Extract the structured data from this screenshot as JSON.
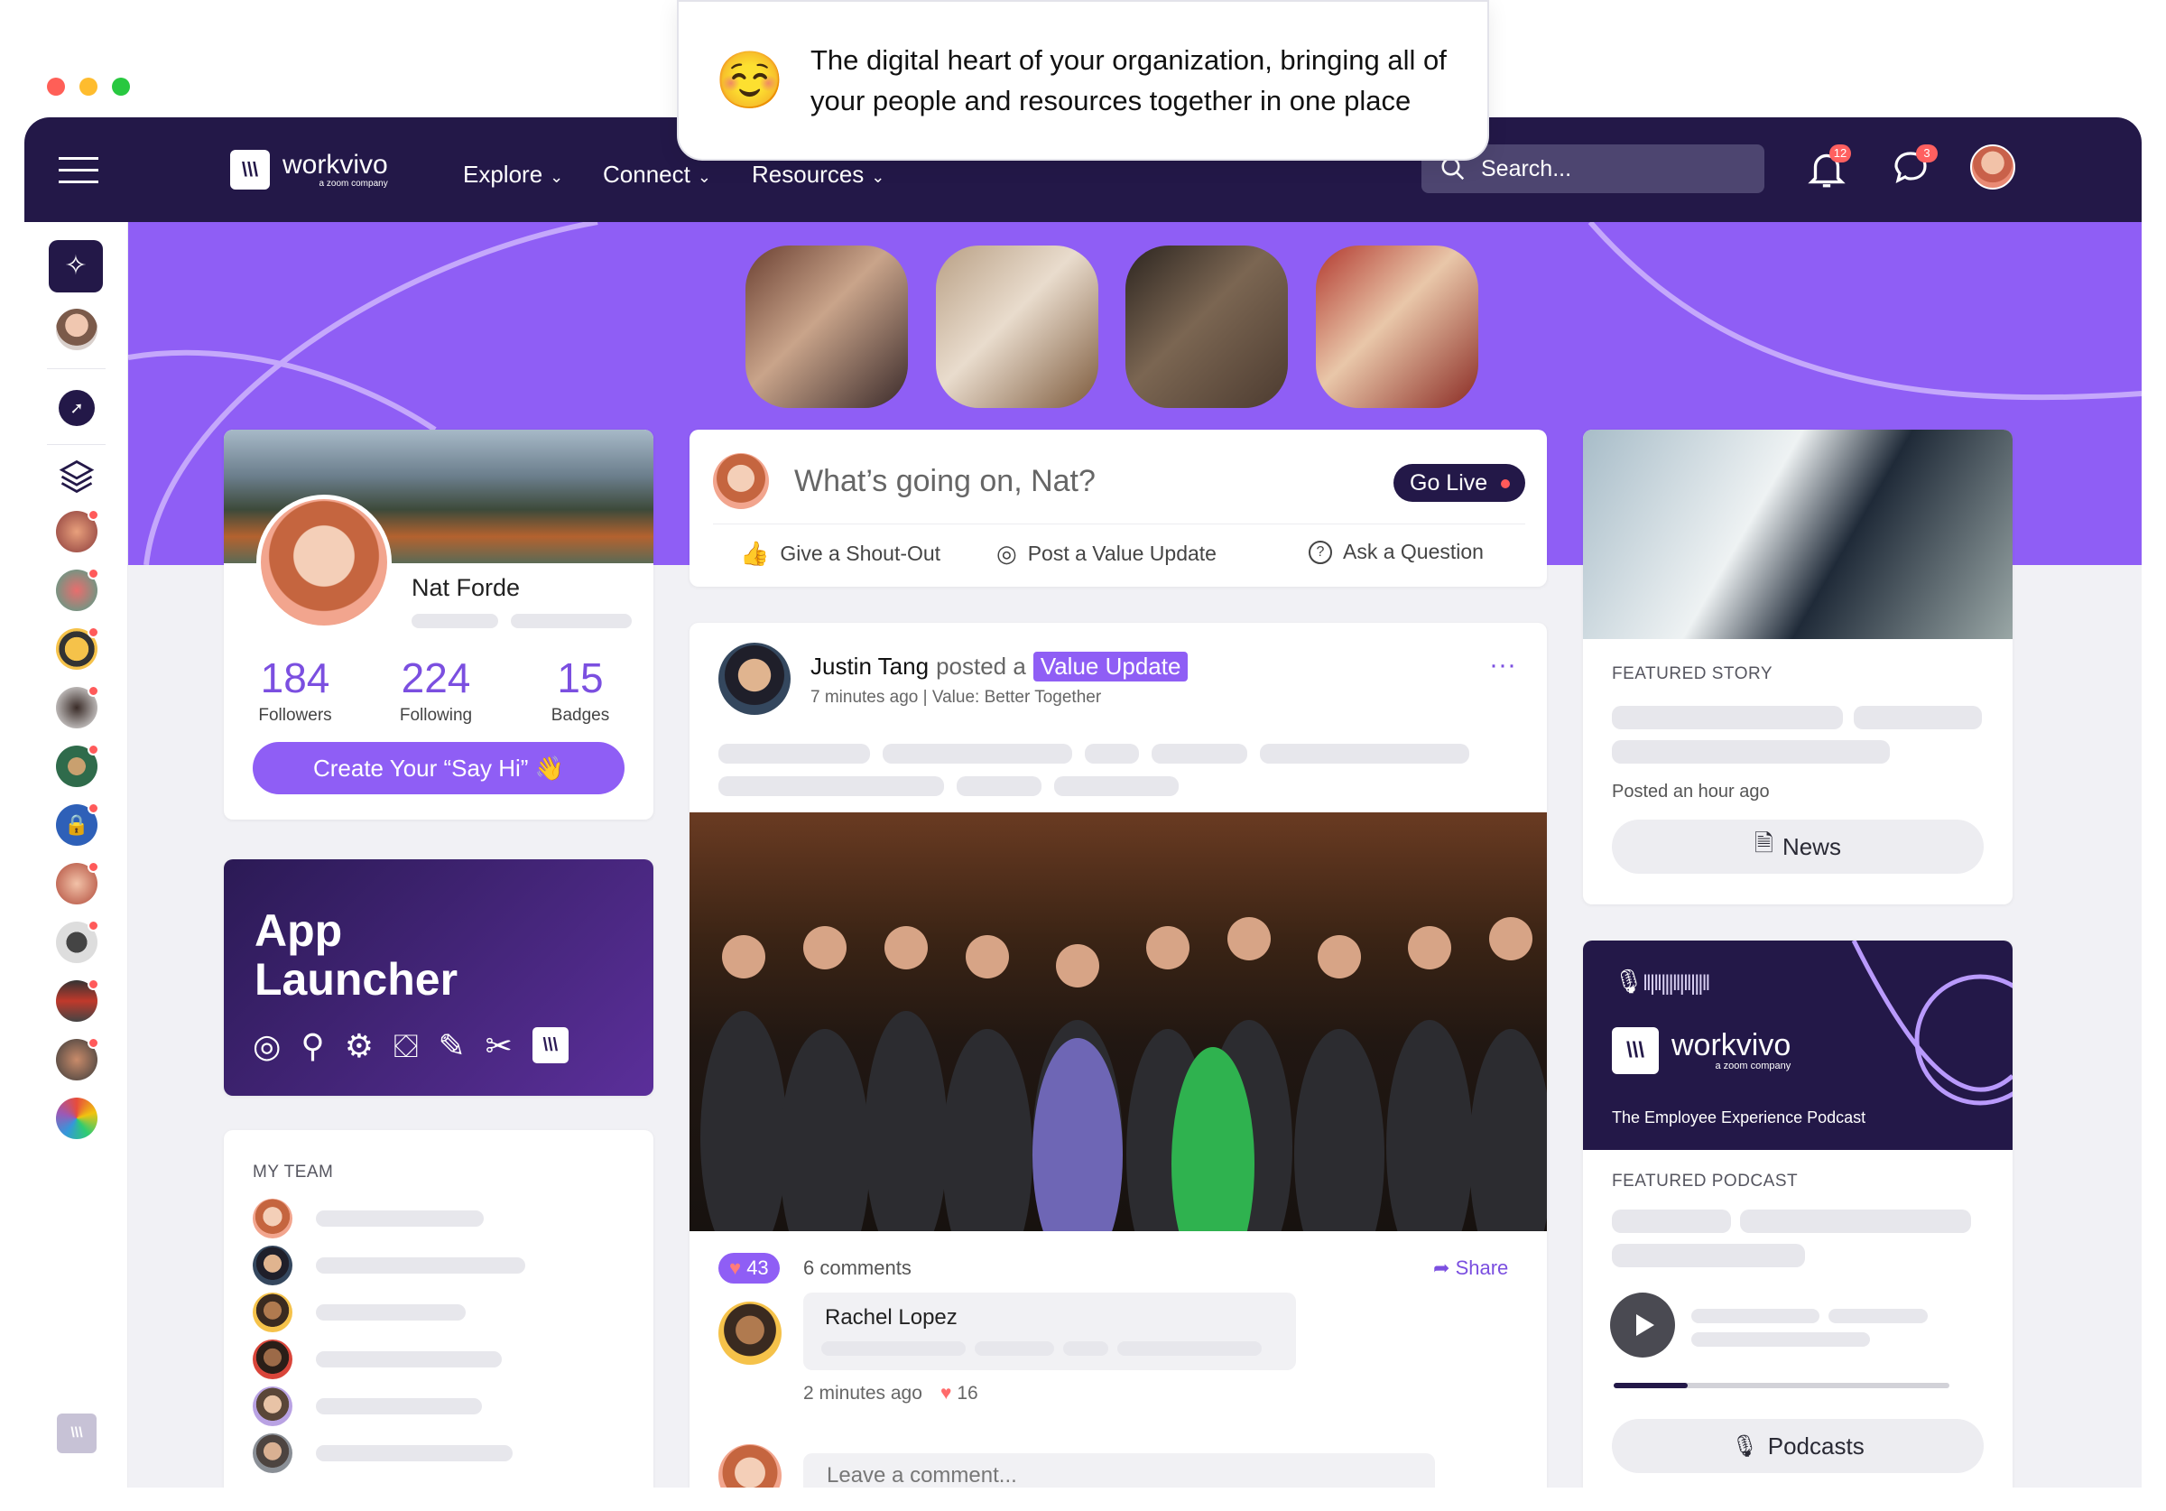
{
  "banner": {
    "emoji": "☺️",
    "text": "The digital heart of your organization, bringing all of your people and resources together in one place"
  },
  "nav": {
    "brand": "workvivo",
    "brand_sub": "a zoom company",
    "links": [
      "Explore",
      "Connect",
      "Resources"
    ],
    "search_placeholder": "Search...",
    "notifications_count": "12",
    "messages_count": "3"
  },
  "profile": {
    "name": "Nat Forde",
    "followers": "184",
    "followers_label": "Followers",
    "following": "224",
    "following_label": "Following",
    "badges": "15",
    "badges_label": "Badges",
    "say_hi_label": "Create Your “Say Hi” 👋"
  },
  "app_launcher": {
    "title_line1": "App",
    "title_line2": "Launcher"
  },
  "team": {
    "heading": "MY TEAM",
    "members": [
      {
        "status": "online"
      },
      {
        "status": "online"
      },
      {
        "status": "away"
      },
      {
        "status": "online"
      },
      {
        "status": "online"
      },
      {
        "status": "away"
      }
    ]
  },
  "composer": {
    "prompt": "What’s going on, Nat?",
    "go_live": "Go Live",
    "actions": [
      "Give a Shout-Out",
      "Post a Value Update",
      "Ask a Question"
    ]
  },
  "post": {
    "author": "Justin Tang",
    "verb": "posted a",
    "tag": "Value Update",
    "meta": "7 minutes ago | Value: Better Together",
    "likes": "43",
    "comments": "6 comments",
    "share": "Share",
    "comment_author": "Rachel Lopez",
    "comment_time": "2 minutes ago",
    "comment_likes": "16",
    "leave_comment": "Leave a comment..."
  },
  "featured_story": {
    "label": "FEATURED STORY",
    "posted": "Posted an hour ago",
    "button": "News"
  },
  "podcast": {
    "brand": "workvivo",
    "brand_sub": "a zoom company",
    "subtitle": "The Employee Experience Podcast",
    "label": "FEATURED PODCAST",
    "progress": 0.22,
    "button": "Podcasts"
  },
  "colors": {
    "nav_bg": "#231848",
    "accent": "#8f5ef5",
    "online": "#2fbf5b",
    "away": "#f5b324"
  }
}
